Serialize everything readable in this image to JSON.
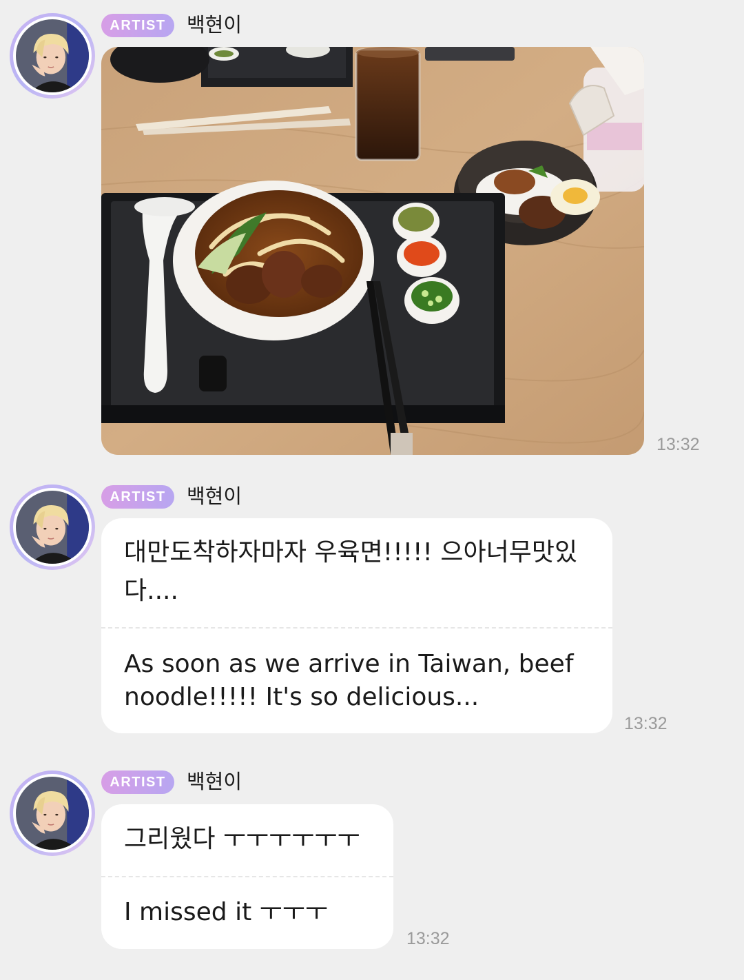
{
  "messages": [
    {
      "badge": "ARTIST",
      "sender": "백현이",
      "type": "photo",
      "time": "13:32"
    },
    {
      "badge": "ARTIST",
      "sender": "백현이",
      "type": "text",
      "original": "대만도착하자마자 우육면!!!!! 으아너무맛있다....",
      "translation": "As soon as we arrive in Taiwan, beef noodle!!!!! It's so delicious...",
      "time": "13:32"
    },
    {
      "badge": "ARTIST",
      "sender": "백현이",
      "type": "text",
      "original": "그리웠다 ㅜㅜㅜㅜㅜㅜ",
      "translation": "I missed it ㅜㅜㅜ",
      "time": "13:32"
    }
  ],
  "icons": [
    "avatar-photo",
    "food-photo"
  ],
  "colors": {
    "background": "#efefef",
    "bubble": "#ffffff",
    "badge_start": "#d79ee6",
    "badge_end": "#b7a6f1",
    "time": "#9a9a9a"
  }
}
